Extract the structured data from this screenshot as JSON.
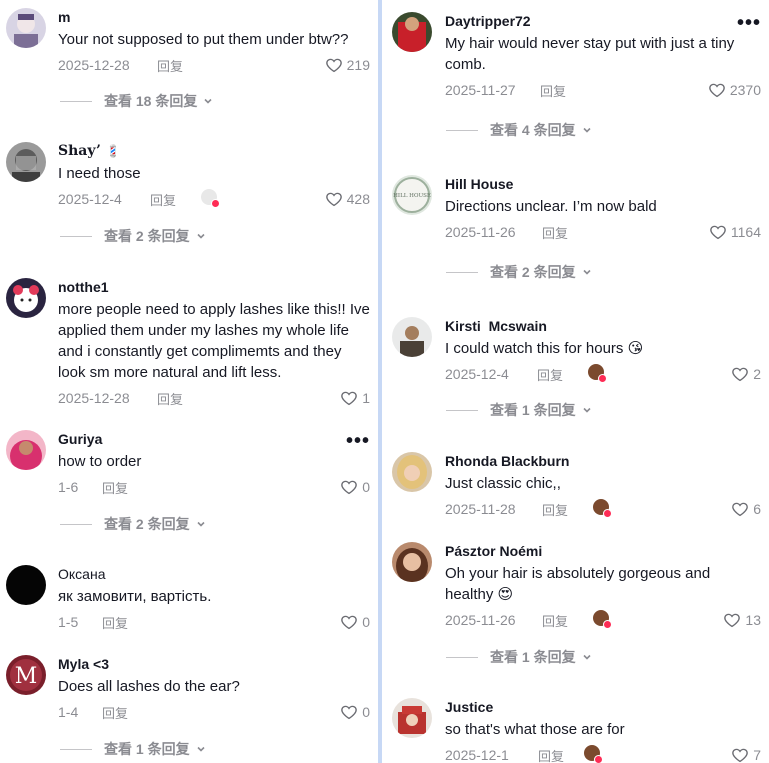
{
  "reply_label": "回复",
  "left": [
    {
      "username": "m",
      "text": "Your not supposed to put them under btw??",
      "date": "2025-12-28",
      "likes": "219",
      "replies": "查看 18 条回复"
    },
    {
      "username": "Shay’",
      "emoji": "💈",
      "text": "I need those",
      "date": "2025-12-4",
      "likes": "428",
      "replies": "查看 2 条回复"
    },
    {
      "username": "notthe1",
      "text": "more people need to apply lashes like this!! Ive applied them under my lashes my whole life and i constantly get complimemts and they look sm more natural and lift less.",
      "date": "2025-12-28",
      "likes": "1"
    },
    {
      "username": "Guriya",
      "text": "how to order",
      "date": "1-6",
      "likes": "0",
      "replies": "查看 2 条回复"
    },
    {
      "username": "Оксана",
      "text": "як замовити, вартість.",
      "date": "1-5",
      "likes": "0"
    },
    {
      "username": "Myla <3",
      "text": "Does all lashes do the ear?",
      "date": "1-4",
      "likes": "0",
      "replies": "查看 1 条回复",
      "avatar_letter": "M"
    }
  ],
  "right": [
    {
      "username": "Daytripper72",
      "text": "My hair would never stay put with just a tiny comb.",
      "date": "2025-11-27",
      "likes": "2370",
      "replies": "查看 4 条回复"
    },
    {
      "username": "Hill House",
      "text": "Directions unclear. I’m now bald",
      "date": "2025-11-26",
      "likes": "1164",
      "replies": "查看 2 条回复",
      "avatar_text": "HILL HOUSE"
    },
    {
      "username": "Kirsti  Mcswain",
      "text": "I could watch this for hours 😘",
      "date": "2025-12-4",
      "likes": "2",
      "replies": "查看 1 条回复"
    },
    {
      "username": "Rhonda Blackburn",
      "text": "Just classic chic,,",
      "date": "2025-11-28",
      "likes": "6"
    },
    {
      "username": "Pásztor Noémi",
      "text": "Oh your hair is absolutely gorgeous and healthy 😍",
      "date": "2025-11-26",
      "likes": "13",
      "replies": "查看 1 条回复"
    },
    {
      "username": "Justice",
      "text": "so that's what those are for",
      "date": "2025-12-1",
      "likes": "7"
    }
  ],
  "colors": {
    "accent": "#fe2c55",
    "muted": "#8a8b91",
    "divider": "#c7d8f5"
  }
}
